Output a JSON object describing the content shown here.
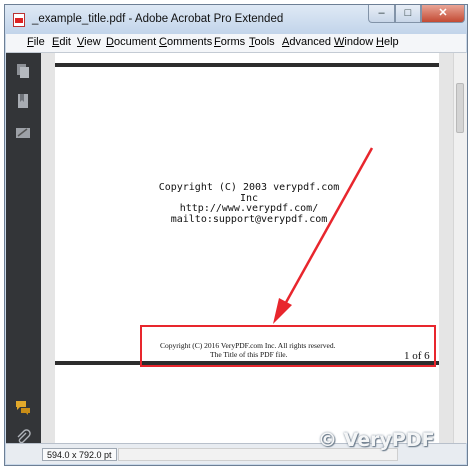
{
  "window": {
    "title": "_example_title.pdf - Adobe Acrobat Pro Extended",
    "buttons": {
      "minimize": "–",
      "maximize": "□",
      "close": "✕"
    }
  },
  "menu": [
    "File",
    "Edit",
    "View",
    "Document",
    "Comments",
    "Forms",
    "Tools",
    "Advanced",
    "Window",
    "Help"
  ],
  "sidebar": {
    "icons": [
      "pages-icon",
      "bookmarks-icon",
      "signatures-icon",
      "comments-icon",
      "attachments-icon"
    ]
  },
  "document": {
    "body_lines": [
      "Copyright (C) 2003 verypdf.com Inc",
      "http://www.verypdf.com/",
      "mailto:support@verypdf.com"
    ],
    "footer_line1": "Copyright (C) 2016 VeryPDF.com Inc. All rights reserved.",
    "footer_line2": "The Title of this PDF file.",
    "page_number": "1 of 6"
  },
  "annotation": {
    "color": "#e8262d"
  },
  "status": {
    "page_size": "594.0 x 792.0 pt"
  },
  "watermark": {
    "text": "© VeryPDF"
  }
}
